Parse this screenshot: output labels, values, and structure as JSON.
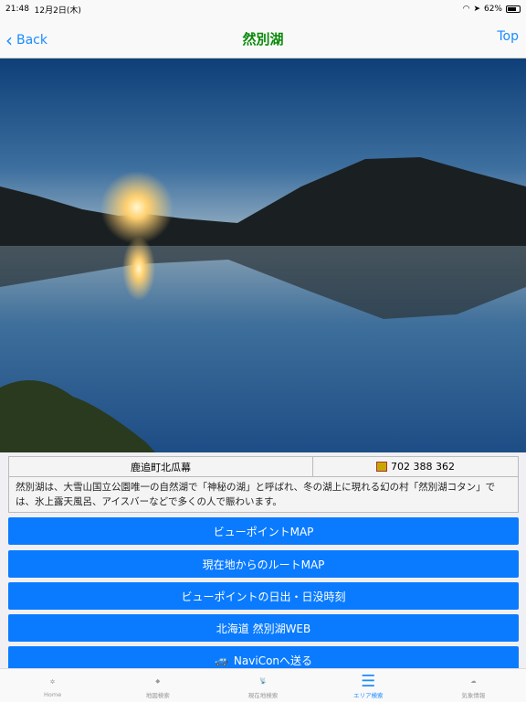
{
  "status": {
    "time": "21:48",
    "date": "12月2日(木)",
    "battery": "62%"
  },
  "nav": {
    "back": "Back",
    "title": "然別湖",
    "top": "Top"
  },
  "info": {
    "address": "鹿追町北瓜幕",
    "mapcode": "702 388 362",
    "description": "然別湖は、大雪山国立公園唯一の自然湖で「神秘の湖」と呼ばれ、冬の湖上に現れる幻の村「然別湖コタン」では、氷上露天風呂、アイスバーなどで多くの人で賑わいます。"
  },
  "buttons": [
    "ビューポイントMAP",
    "現在地からのルートMAP",
    "ビューポイントの日出・日没時刻",
    "北海道 然別湖WEB",
    "NaviConへ送る"
  ],
  "tabs": [
    {
      "label": "Home",
      "icon": "home-icon"
    },
    {
      "label": "地図検索",
      "icon": "hokkaido-map-icon"
    },
    {
      "label": "現在地検索",
      "icon": "satellite-dish-icon"
    },
    {
      "label": "エリア検索",
      "icon": "list-icon"
    },
    {
      "label": "気象情報",
      "icon": "weather-icon"
    }
  ],
  "colors": {
    "accent": "#0a7bff",
    "title": "#0a8a0a"
  }
}
